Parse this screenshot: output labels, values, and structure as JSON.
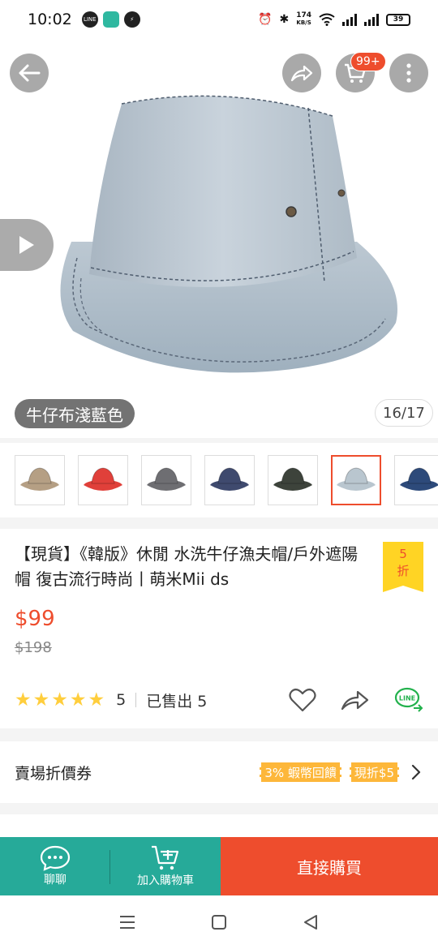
{
  "status_bar": {
    "time": "10:02",
    "apps": [
      "LINE",
      "",
      ""
    ],
    "net_speed_value": "174",
    "net_speed_unit": "KB/S",
    "battery": "39"
  },
  "header": {
    "cart_badge": "99+"
  },
  "gallery": {
    "variant_label": "牛仔布淺藍色",
    "counter": "16/17",
    "thumbnails": [
      {
        "color": "#b59f84"
      },
      {
        "color": "#e0403a"
      },
      {
        "color": "#6e6e72"
      },
      {
        "color": "#3f4a6e"
      },
      {
        "color": "#3d433b"
      },
      {
        "color": "#b9c6cf",
        "selected": true
      },
      {
        "color": "#2d4a7a"
      }
    ]
  },
  "product": {
    "title": "【現貨】《韓版》休閒 水洗牛仔漁夫帽/戶外遮陽帽 復古流行時尚丨萌米Mii ds",
    "discount_value": "5",
    "discount_unit": "折",
    "price": "$99",
    "original_price": "$198",
    "rating": 5,
    "rating_count": "5",
    "sold": "已售出 5"
  },
  "coupon": {
    "label": "賣場折價券",
    "tags": [
      "3% 蝦幣回饋",
      "現折$5"
    ]
  },
  "bottom_bar": {
    "chat_label": "聊聊",
    "cart_label": "加入購物車",
    "buy_label": "直接購買"
  },
  "colors": {
    "accent": "#ee4d2d",
    "teal": "#26aa99",
    "star": "#ffce3d",
    "discount_bg": "#ffd424"
  }
}
